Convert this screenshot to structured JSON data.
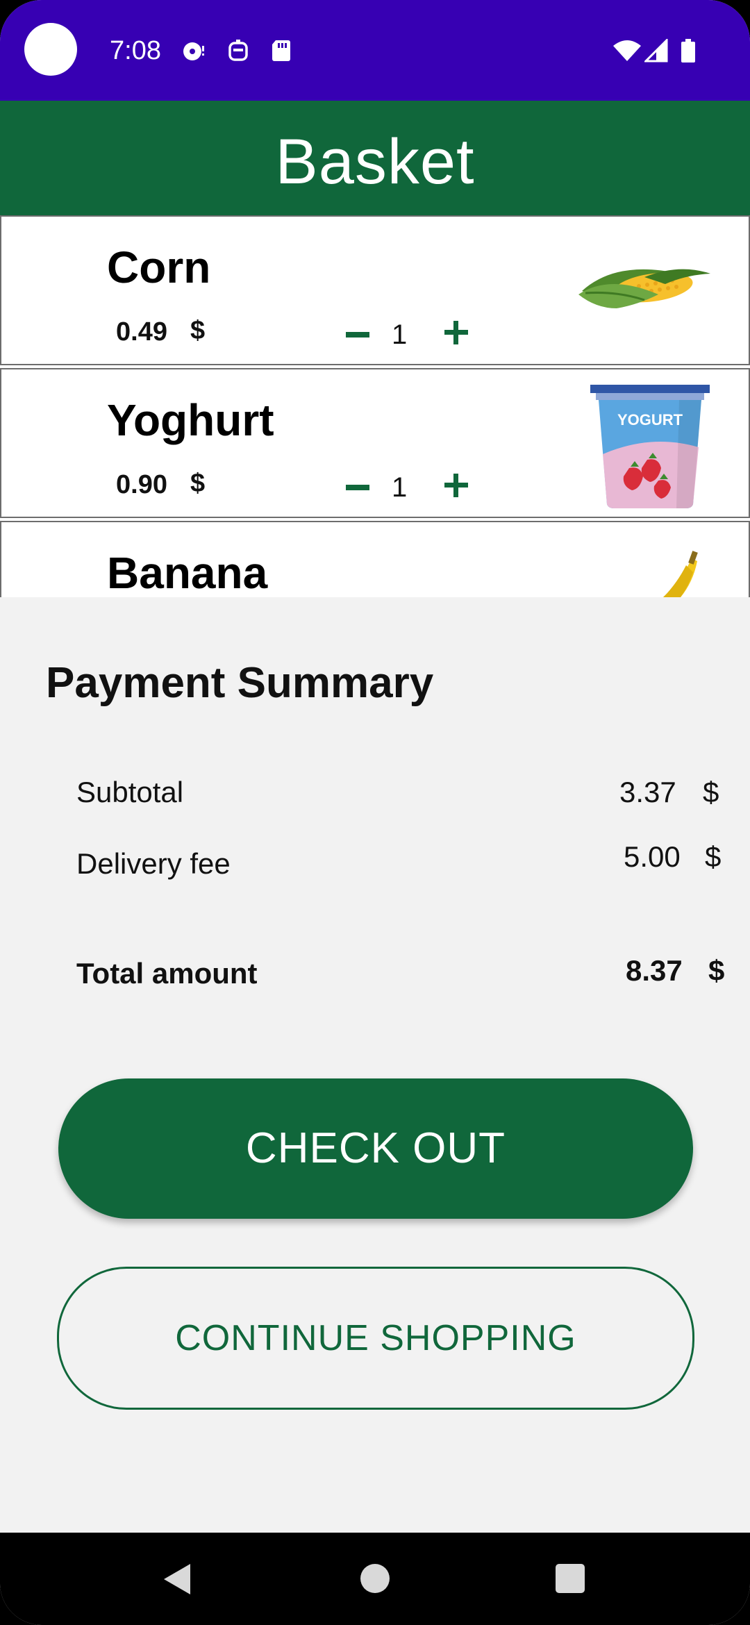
{
  "status_bar": {
    "time": "7:08",
    "left_icons": [
      "disc-icon",
      "robot-icon",
      "sd-card-icon"
    ],
    "right_icons": [
      "wifi-icon",
      "signal-icon",
      "battery-icon"
    ],
    "background_color": "#3700b3"
  },
  "app_bar": {
    "title": "Basket",
    "background_color": "#10673b"
  },
  "basket": {
    "items": [
      {
        "name": "Corn",
        "price": "0.49",
        "currency": "$",
        "quantity": "1",
        "image_icon": "corn-icon"
      },
      {
        "name": "Yoghurt",
        "price": "0.90",
        "currency": "$",
        "quantity": "1",
        "image_icon": "yogurt-cup-icon",
        "image_text": "YOGURT"
      },
      {
        "name": "Banana",
        "image_icon": "banana-icon"
      }
    ]
  },
  "summary": {
    "title": "Payment Summary",
    "subtotal_label": "Subtotal",
    "subtotal_value": "3.37",
    "delivery_label": "Delivery fee",
    "delivery_value": "5.00",
    "total_label": "Total amount",
    "total_value": "8.37",
    "currency": "$"
  },
  "actions": {
    "checkout_label": "CHECK OUT",
    "continue_label": "CONTINUE SHOPPING",
    "accent_color": "#10673b"
  },
  "nav_bar": {
    "icons": [
      "back-icon",
      "home-icon",
      "recents-icon"
    ]
  }
}
